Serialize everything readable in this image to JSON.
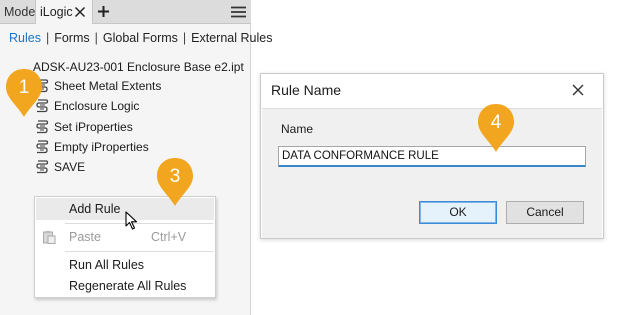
{
  "browser": {
    "tabs": {
      "model": "Model",
      "ilogic": "iLogic"
    },
    "subnav": {
      "rules": "Rules",
      "forms": "Forms",
      "global_forms": "Global Forms",
      "external_rules": "External Rules",
      "separator": "|"
    },
    "tree": {
      "root": "ADSK-AU23-001 Enclosure Base e2.ipt",
      "rules": [
        "Sheet Metal Extents",
        "Enclosure Logic",
        "Set iProperties",
        "Empty iProperties",
        "SAVE"
      ]
    }
  },
  "context_menu": {
    "add_rule": "Add Rule",
    "paste": "Paste",
    "paste_shortcut": "Ctrl+V",
    "run_all": "Run All Rules",
    "regenerate_all": "Regenerate All Rules"
  },
  "callouts": [
    "1",
    "3",
    "4"
  ],
  "dialog": {
    "title": "Rule Name",
    "name_label": "Name",
    "name_value": "DATA CONFORMANCE RULE",
    "ok": "OK",
    "cancel": "Cancel"
  },
  "colors": {
    "callout": "#f2a51e",
    "active_link": "#1a73c8",
    "focus": "#3a86c8"
  },
  "icons": [
    "close-icon",
    "plus-icon",
    "menu-icon",
    "rule-icon",
    "paste-icon",
    "mouse-cursor-icon"
  ]
}
